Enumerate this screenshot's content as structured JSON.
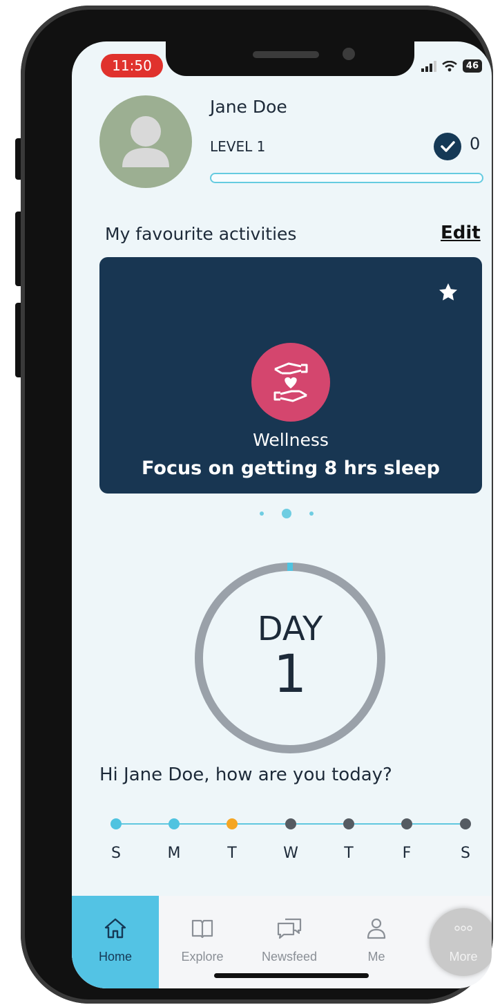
{
  "status_bar": {
    "time": "11:50",
    "battery": "46"
  },
  "profile": {
    "name": "Jane Doe",
    "level": "LEVEL 1",
    "points": "0",
    "level_progress": 0
  },
  "favourites": {
    "title": "My favourite activities",
    "edit_label": "Edit",
    "card": {
      "category": "Wellness",
      "description": "Focus on getting 8 hrs sleep",
      "icon": "caring-hands-heart-icon",
      "starred": true
    },
    "pagination": {
      "total": 3,
      "active_index": 1
    }
  },
  "day_counter": {
    "label": "DAY",
    "number": "1"
  },
  "greeting": "Hi Jane Doe, how are you today?",
  "week": {
    "days": [
      "S",
      "M",
      "T",
      "W",
      "T",
      "F",
      "S"
    ],
    "dot_colors": [
      "#4fc3e0",
      "#4fc3e0",
      "#f5a623",
      "#555b62",
      "#555b62",
      "#555b62",
      "#555b62"
    ]
  },
  "tabs": [
    {
      "label": "Home",
      "icon": "home-icon",
      "active": true
    },
    {
      "label": "Explore",
      "icon": "book-icon",
      "active": false
    },
    {
      "label": "Newsfeed",
      "icon": "chat-bubbles-icon",
      "active": false
    },
    {
      "label": "Me",
      "icon": "user-icon",
      "active": false
    },
    {
      "label": "More",
      "icon": "more-icon",
      "active": false
    }
  ],
  "colors": {
    "accent": "#53c3e4",
    "card_bg": "#183652",
    "wellness": "#d4466e",
    "time_pill": "#e0322d"
  }
}
